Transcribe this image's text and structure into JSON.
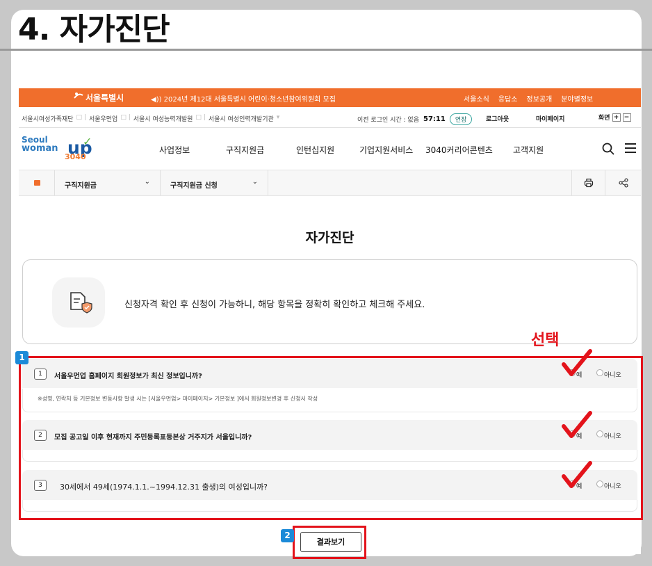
{
  "step_title": "4. 자가진단",
  "topbar": {
    "logo": "서울특별시",
    "notice": "◀)) 2024년 제12대 서울특별시 어린이·청소년참여위원회 모집",
    "links": [
      "서울소식",
      "응답소",
      "정보공개",
      "분야별정보"
    ]
  },
  "subbar": {
    "sites": [
      "서울시여성가족재단",
      "서울우먼업",
      "서울시 여성능력개발원",
      "서울시 여성인력개발기관"
    ],
    "last_login": "이전 로그인 시간 : 없음",
    "timer": "57:11",
    "extend_label": "연장",
    "logout": "로그아웃",
    "mypage": "마이페이지",
    "screen_label": "화면",
    "zoom_in": "+",
    "zoom_out": "−"
  },
  "brand": {
    "line1": "Seoul",
    "line2": "woman",
    "up": "up",
    "years": "3040"
  },
  "menu": [
    "사업정보",
    "구직지원금",
    "인턴십지원",
    "기업지원서비스",
    "3040커리어콘텐츠",
    "고객지원"
  ],
  "breadcrumb": {
    "level1": "구직지원금",
    "level2": "구직지원금 신청"
  },
  "page_heading": "자가진단",
  "notice_text": "신청자격 확인 후 신청이 가능하니, 해당 항목을 정확히 확인하고 체크해 주세요.",
  "questions": [
    {
      "num": "1",
      "text": "서울우먼업 홈페이지 회원정보가 최신 정보입니까?",
      "note": "※성명, 연락처 등 기본정보 변동사항 발생 시는 [서울우먼업> 마이페이지> 기본정보 ]에서 회원정보변경 후 신청서 작성",
      "yes": "예",
      "no": "아니오"
    },
    {
      "num": "2",
      "text": "모집 공고일 이후 현재까지 주민등록표등본상 거주지가 서울입니까?",
      "note": "",
      "yes": "예",
      "no": "아니오"
    },
    {
      "num": "3",
      "text": "30세에서 49세(1974.1.1.~1994.12.31 출생)의 여성입니까?",
      "note": "",
      "yes": "예",
      "no": "아니오"
    }
  ],
  "result_button": "결과보기",
  "annotations": {
    "select_label": "선택",
    "badge1": "1",
    "badge2": "2",
    "color": "#e3131b",
    "badge_color": "#1b8ad8"
  },
  "colors": {
    "topbar": "#f06e2c",
    "brand_blue": "#1a5aa3"
  }
}
